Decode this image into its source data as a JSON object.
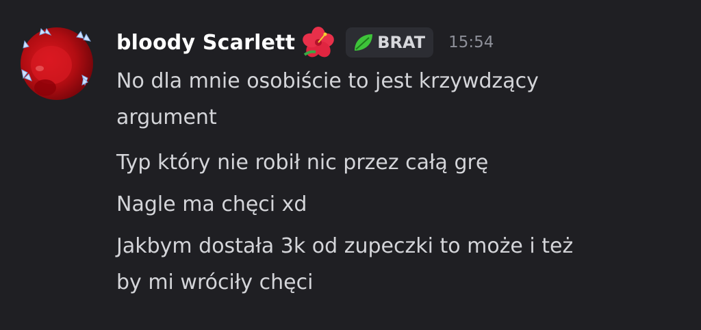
{
  "message": {
    "username": "bloody Scarlett",
    "username_emoji": "hibiscus-flower",
    "tag": {
      "icon": "leaf-icon",
      "label": "BRAT"
    },
    "timestamp": "15:54",
    "lines": [
      "No dla mnie osobiście to jest krzywdzący",
      "argument",
      "Typ który nie robił nic przez całą grę",
      "Nagle ma chęci xd",
      "Jakbym dostała 3k od zupeczki to może i też",
      "by mi wróciły chęci"
    ]
  },
  "colors": {
    "background": "#1f1f23",
    "username": "#ffffff",
    "text": "#d4d5d9",
    "timestamp": "#8e9099",
    "tag_bg": "#2c2d33",
    "leaf": "#3ec43a",
    "flower": "#e8304a"
  }
}
